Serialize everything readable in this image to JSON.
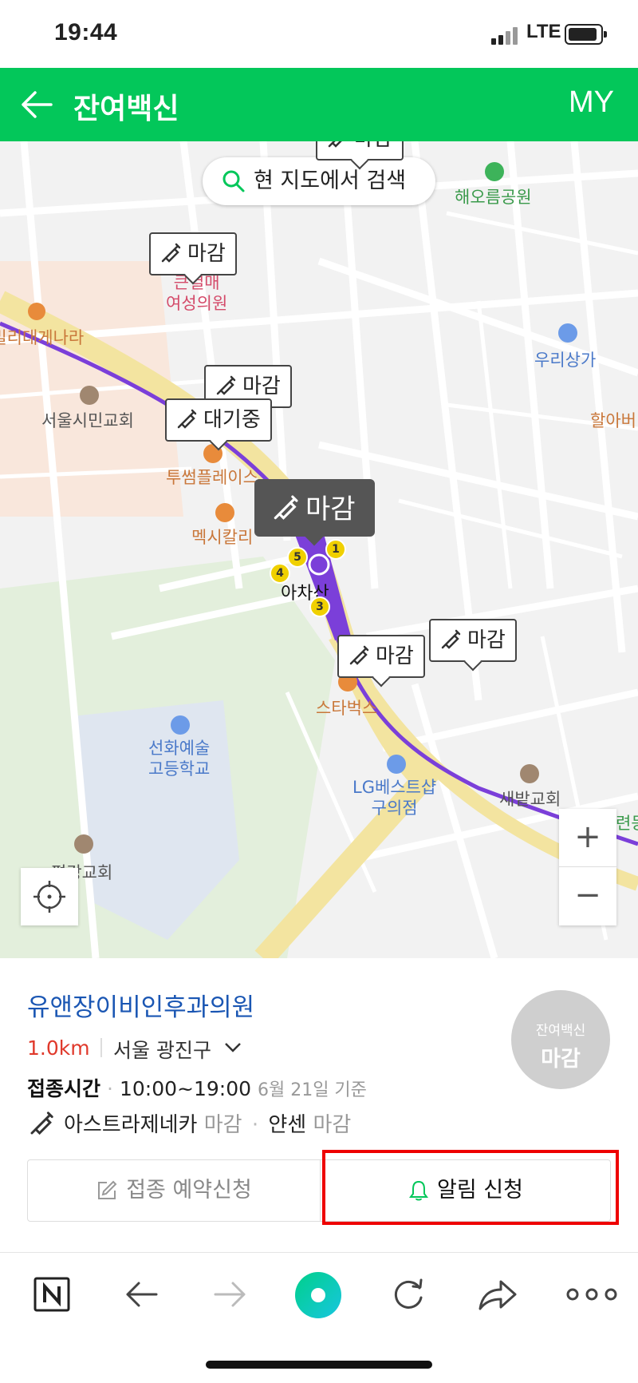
{
  "status_bar": {
    "time": "19:44",
    "network": "LTE"
  },
  "header": {
    "title": "잔여백신",
    "my_label": "MY"
  },
  "map": {
    "search_button": "현 지도에서 검색",
    "markers": [
      {
        "label": "마감"
      },
      {
        "label": "마감"
      },
      {
        "label": "마감"
      },
      {
        "label": "대기중"
      },
      {
        "label": "마감"
      },
      {
        "label": "마감"
      },
      {
        "label": "마감"
      }
    ],
    "places": {
      "park": "해오름공원",
      "clinic1": "큰열매\n여성의원",
      "restaurant": "패밀리대게나라",
      "mall": "우리상가",
      "church1": "서울시민교회",
      "cafe1": "투썸플레이스",
      "restaurant2": "멕시칼리",
      "station": "아차산",
      "starbucks": "스타벅스",
      "school": "선화예술\n고등학교",
      "store": "LG베스트샵\n구의점",
      "church2": "새밭교회",
      "church3": "평강교회",
      "right1": "할아버",
      "right2": "련동"
    },
    "zoom_in": "+",
    "zoom_out": "−"
  },
  "panel": {
    "clinic_name": "유앤장이비인후과의원",
    "distance": "1.0km",
    "region": "서울 광진구",
    "hours_label": "접종시간",
    "hours_value": "10:00~19:00",
    "as_of": "6월 21일 기준",
    "vaccine1": "아스트라제네카",
    "vaccine1_status": "마감",
    "vaccine2": "얀센",
    "vaccine2_status": "마감",
    "badge_top": "잔여백신",
    "badge_bottom": "마감",
    "reserve_button": "접종 예약신청",
    "alarm_button": "알림 신청"
  },
  "colors": {
    "brand_green": "#03c75a",
    "subway_purple": "#7b3fd9",
    "highlight_red": "#e00000"
  },
  "icons": [
    "back-arrow-icon",
    "search-icon",
    "syringe-icon",
    "locate-icon",
    "pencil-edit-icon",
    "bell-icon",
    "naver-n-icon",
    "browser-back-icon",
    "browser-forward-icon",
    "home-circle-icon",
    "refresh-icon",
    "share-icon",
    "more-icon"
  ]
}
